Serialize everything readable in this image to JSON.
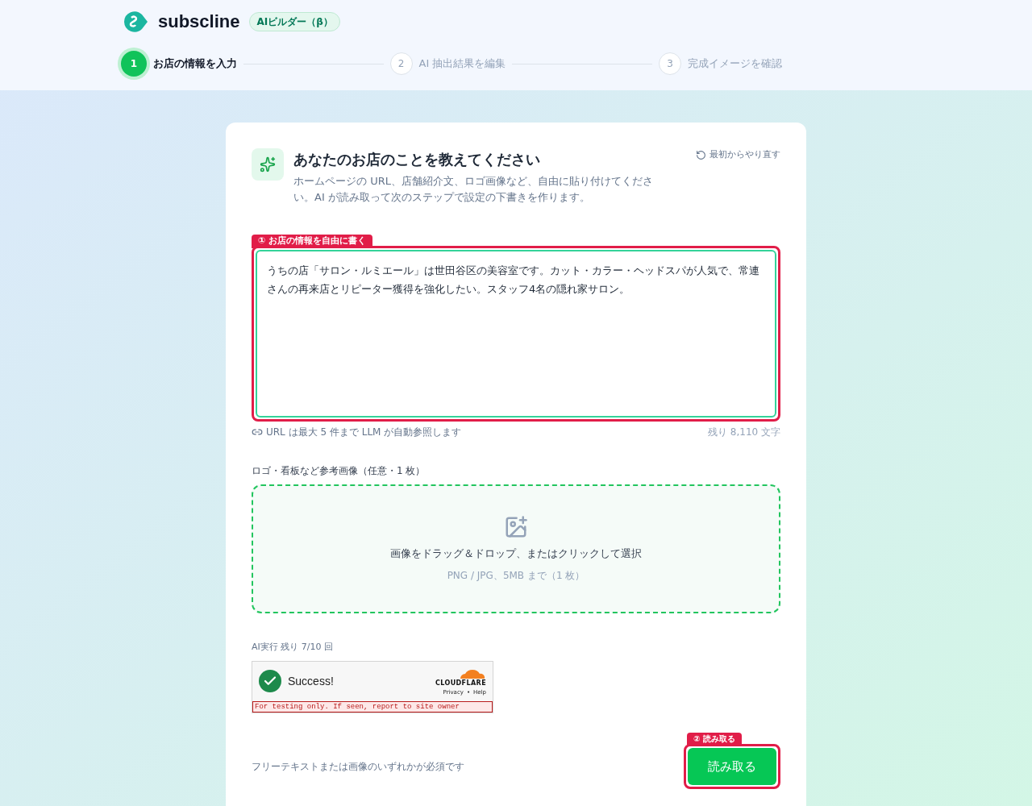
{
  "header": {
    "brand": "subscline",
    "badge": "AIビルダー（β）"
  },
  "steps": [
    {
      "number": "1",
      "label": "お店の情報を入力",
      "selected": true
    },
    {
      "number": "2",
      "label": "AI 抽出結果を編集",
      "selected": false
    },
    {
      "number": "3",
      "label": "完成イメージを確認",
      "selected": false
    }
  ],
  "card": {
    "title": "あなたのお店のことを教えてください",
    "description": "ホームページの URL、店舗紹介文、ロゴ画像など、自由に貼り付けてください。AI が読み取って次のステップで設定の下書きを作ります。",
    "reset": "最初からやり直す",
    "text_tag": "① お店の情報を自由に書く",
    "text_value": "うちの店「サロン・ルミエール」は世田谷区の美容室です。カット・カラー・ヘッドスパが人気で、常連さんの再来店とリピーター獲得を強化したい。スタッフ4名の隠れ家サロン。",
    "url_hint": "URL は最大 5 件まで LLM が自動参照します",
    "remaining": "残り 8,110 文字",
    "image_label": "ロゴ・看板など参考画像（任意・1 枚）",
    "drop_text": "画像をドラッグ＆ドロップ、またはクリックして選択",
    "drop_hint": "PNG / JPG、5MB まで（1 枚）",
    "quota": "AI実行 残り 7/10 回",
    "captcha": {
      "status": "Success!",
      "brand": "CLOUDFLARE",
      "privacy": "Privacy",
      "separator": "•",
      "help": "Help",
      "warning": "For testing only. If seen, report to site owner"
    },
    "required_note": "フリーテキストまたは画像のいずれかが必須です",
    "submit_tag": "② 読み取る",
    "submit": "読み取る"
  }
}
